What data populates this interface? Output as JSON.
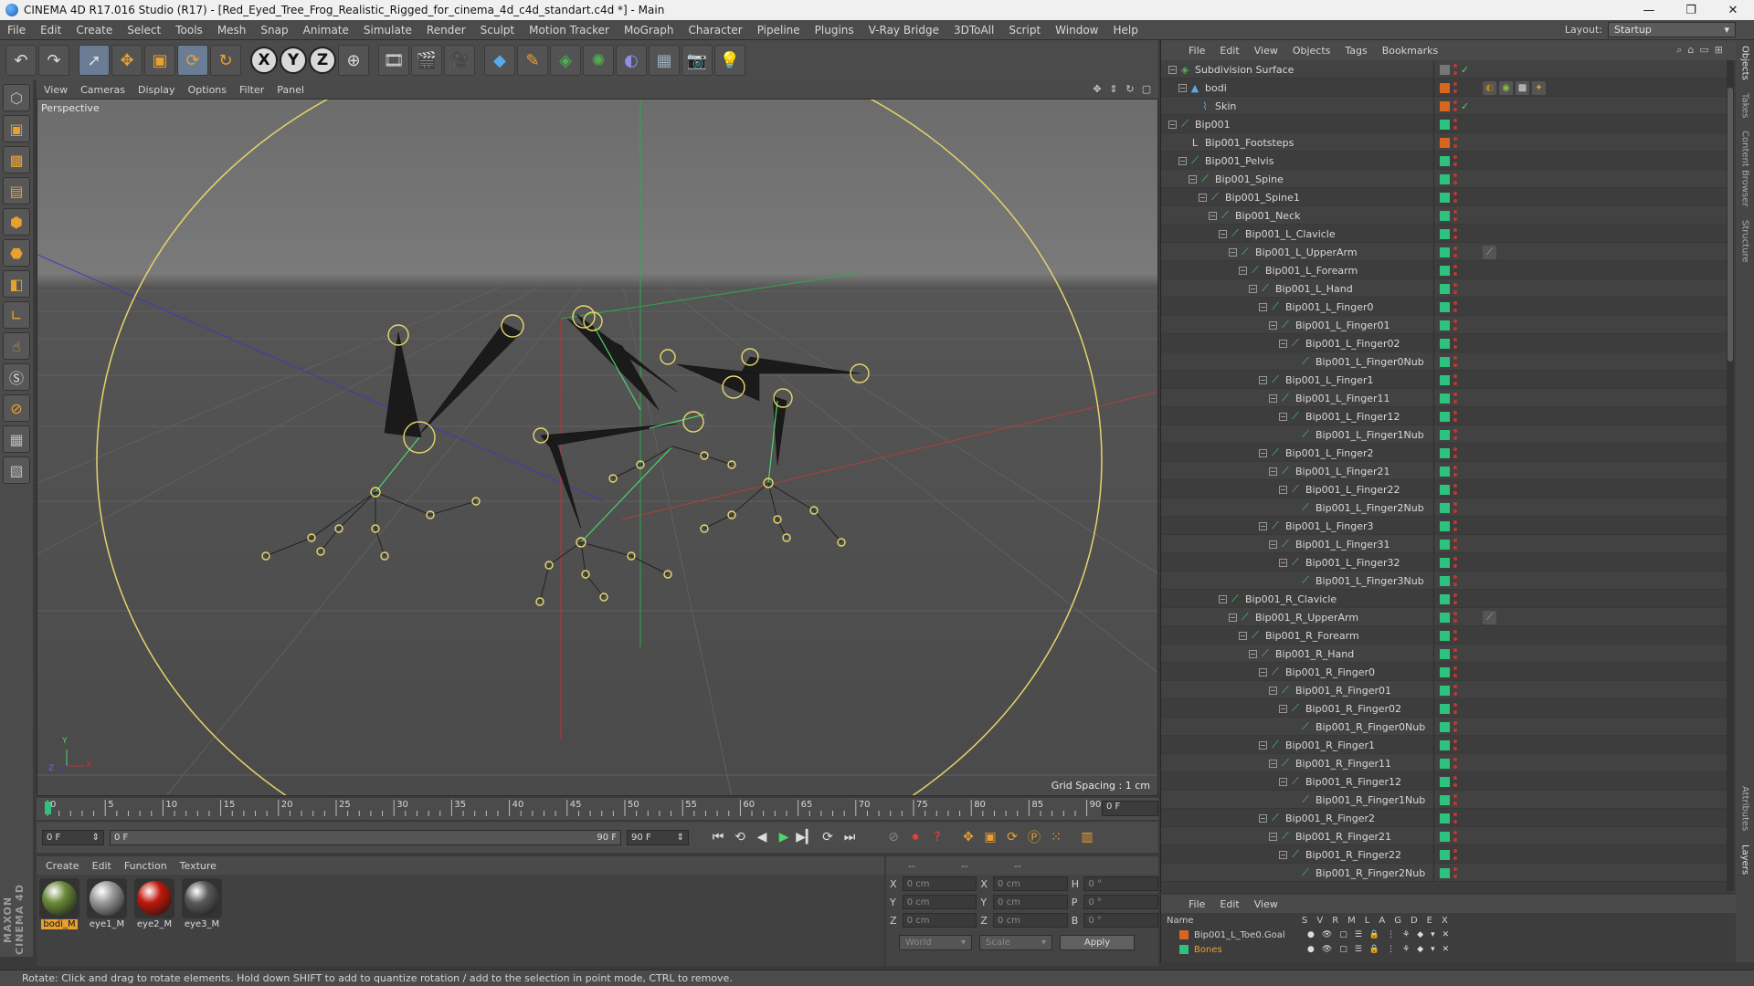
{
  "window": {
    "title": "CINEMA 4D R17.016 Studio (R17) - [Red_Eyed_Tree_Frog_Realistic_Rigged_for_cinema_4d_c4d_standart.c4d *] - Main",
    "minimize": "—",
    "maximize": "❐",
    "close": "✕"
  },
  "menu": [
    "File",
    "Edit",
    "Create",
    "Select",
    "Tools",
    "Mesh",
    "Snap",
    "Animate",
    "Simulate",
    "Render",
    "Sculpt",
    "Motion Tracker",
    "MoGraph",
    "Character",
    "Pipeline",
    "Plugins",
    "V-Ray Bridge",
    "3DToAll",
    "Script",
    "Window",
    "Help"
  ],
  "layout": {
    "label": "Layout:",
    "value": "Startup"
  },
  "toolbar_axes": [
    "X",
    "Y",
    "Z"
  ],
  "viewport": {
    "menu": [
      "View",
      "Cameras",
      "Display",
      "Options",
      "Filter",
      "Panel"
    ],
    "label": "Perspective",
    "grid_spacing": "Grid Spacing : 1 cm",
    "axis_y": "Y",
    "axis_x": "X",
    "axis_z": "Z"
  },
  "timeline": {
    "ticks": [
      "0",
      "5",
      "10",
      "15",
      "20",
      "25",
      "30",
      "35",
      "40",
      "45",
      "50",
      "55",
      "60",
      "65",
      "70",
      "75",
      "80",
      "85",
      "90"
    ],
    "current_frame": "0 F",
    "start_field": "0 F",
    "range_start": "0 F",
    "range_end": "90 F",
    "end_field": "90 F"
  },
  "materials": {
    "menu": [
      "Create",
      "Edit",
      "Function",
      "Texture"
    ],
    "items": [
      {
        "name": "bodi_M",
        "color": "#6b8a3a",
        "selected": true
      },
      {
        "name": "eye1_M",
        "color": "#9a9a9a",
        "selected": false
      },
      {
        "name": "eye2_M",
        "color": "#c0180c",
        "selected": false
      },
      {
        "name": "eye3_M",
        "color": "#5a5a5a",
        "selected": false
      }
    ]
  },
  "coords": {
    "headers": [
      "--",
      "--",
      "--"
    ],
    "rows": [
      {
        "a1": "X",
        "v1": "0 cm",
        "a2": "X",
        "v2": "0 cm",
        "a3": "H",
        "v3": "0 °"
      },
      {
        "a1": "Y",
        "v1": "0 cm",
        "a2": "Y",
        "v2": "0 cm",
        "a3": "P",
        "v3": "0 °"
      },
      {
        "a1": "Z",
        "v1": "0 cm",
        "a2": "Z",
        "v2": "0 cm",
        "a3": "B",
        "v3": "0 °"
      }
    ],
    "world": "World",
    "scale": "Scale",
    "apply": "Apply"
  },
  "object_manager": {
    "menu": [
      "File",
      "Edit",
      "View",
      "Objects",
      "Tags",
      "Bookmarks"
    ],
    "rows": [
      {
        "name": "Subdivision Surface",
        "depth": 0,
        "exp": true,
        "icon": "subdivision",
        "chip": "#777777",
        "check": true
      },
      {
        "name": "bodi",
        "depth": 1,
        "exp": true,
        "icon": "mesh",
        "chip": "#d9661e",
        "tags": true
      },
      {
        "name": "Skin",
        "depth": 2,
        "exp": false,
        "icon": "skin",
        "chip": "#d9661e",
        "check": true
      },
      {
        "name": "Bip001",
        "depth": 0,
        "exp": true,
        "icon": "bone",
        "chip": "#2ec27e"
      },
      {
        "name": "Bip001_Footsteps",
        "depth": 1,
        "exp": false,
        "icon": "null",
        "chip": "#d9661e"
      },
      {
        "name": "Bip001_Pelvis",
        "depth": 1,
        "exp": true,
        "icon": "bone",
        "chip": "#2ec27e"
      },
      {
        "name": "Bip001_Spine",
        "depth": 2,
        "exp": true,
        "icon": "bone",
        "chip": "#2ec27e"
      },
      {
        "name": "Bip001_Spine1",
        "depth": 3,
        "exp": true,
        "icon": "bone",
        "chip": "#2ec27e"
      },
      {
        "name": "Bip001_Neck",
        "depth": 4,
        "exp": true,
        "icon": "bone",
        "chip": "#2ec27e"
      },
      {
        "name": "Bip001_L_Clavicle",
        "depth": 5,
        "exp": true,
        "icon": "bone",
        "chip": "#2ec27e"
      },
      {
        "name": "Bip001_L_UpperArm",
        "depth": 6,
        "exp": true,
        "icon": "bone",
        "chip": "#2ec27e",
        "ik": true
      },
      {
        "name": "Bip001_L_Forearm",
        "depth": 7,
        "exp": true,
        "icon": "bone",
        "chip": "#2ec27e"
      },
      {
        "name": "Bip001_L_Hand",
        "depth": 8,
        "exp": true,
        "icon": "bone",
        "chip": "#2ec27e"
      },
      {
        "name": "Bip001_L_Finger0",
        "depth": 9,
        "exp": true,
        "icon": "bone",
        "chip": "#2ec27e"
      },
      {
        "name": "Bip001_L_Finger01",
        "depth": 10,
        "exp": true,
        "icon": "bone",
        "chip": "#2ec27e"
      },
      {
        "name": "Bip001_L_Finger02",
        "depth": 11,
        "exp": true,
        "icon": "bone",
        "chip": "#2ec27e"
      },
      {
        "name": "Bip001_L_Finger0Nub",
        "depth": 12,
        "exp": false,
        "icon": "bone",
        "chip": "#2ec27e"
      },
      {
        "name": "Bip001_L_Finger1",
        "depth": 9,
        "exp": true,
        "icon": "bone",
        "chip": "#2ec27e"
      },
      {
        "name": "Bip001_L_Finger11",
        "depth": 10,
        "exp": true,
        "icon": "bone",
        "chip": "#2ec27e"
      },
      {
        "name": "Bip001_L_Finger12",
        "depth": 11,
        "exp": true,
        "icon": "bone",
        "chip": "#2ec27e"
      },
      {
        "name": "Bip001_L_Finger1Nub",
        "depth": 12,
        "exp": false,
        "icon": "bone",
        "chip": "#2ec27e"
      },
      {
        "name": "Bip001_L_Finger2",
        "depth": 9,
        "exp": true,
        "icon": "bone",
        "chip": "#2ec27e"
      },
      {
        "name": "Bip001_L_Finger21",
        "depth": 10,
        "exp": true,
        "icon": "bone",
        "chip": "#2ec27e"
      },
      {
        "name": "Bip001_L_Finger22",
        "depth": 11,
        "exp": true,
        "icon": "bone",
        "chip": "#2ec27e"
      },
      {
        "name": "Bip001_L_Finger2Nub",
        "depth": 12,
        "exp": false,
        "icon": "bone",
        "chip": "#2ec27e"
      },
      {
        "name": "Bip001_L_Finger3",
        "depth": 9,
        "exp": true,
        "icon": "bone",
        "chip": "#2ec27e"
      },
      {
        "name": "Bip001_L_Finger31",
        "depth": 10,
        "exp": true,
        "icon": "bone",
        "chip": "#2ec27e"
      },
      {
        "name": "Bip001_L_Finger32",
        "depth": 11,
        "exp": true,
        "icon": "bone",
        "chip": "#2ec27e"
      },
      {
        "name": "Bip001_L_Finger3Nub",
        "depth": 12,
        "exp": false,
        "icon": "bone",
        "chip": "#2ec27e"
      },
      {
        "name": "Bip001_R_Clavicle",
        "depth": 5,
        "exp": true,
        "icon": "bone",
        "chip": "#2ec27e"
      },
      {
        "name": "Bip001_R_UpperArm",
        "depth": 6,
        "exp": true,
        "icon": "bone",
        "chip": "#2ec27e",
        "ik": true
      },
      {
        "name": "Bip001_R_Forearm",
        "depth": 7,
        "exp": true,
        "icon": "bone",
        "chip": "#2ec27e"
      },
      {
        "name": "Bip001_R_Hand",
        "depth": 8,
        "exp": true,
        "icon": "bone",
        "chip": "#2ec27e"
      },
      {
        "name": "Bip001_R_Finger0",
        "depth": 9,
        "exp": true,
        "icon": "bone",
        "chip": "#2ec27e"
      },
      {
        "name": "Bip001_R_Finger01",
        "depth": 10,
        "exp": true,
        "icon": "bone",
        "chip": "#2ec27e"
      },
      {
        "name": "Bip001_R_Finger02",
        "depth": 11,
        "exp": true,
        "icon": "bone",
        "chip": "#2ec27e"
      },
      {
        "name": "Bip001_R_Finger0Nub",
        "depth": 12,
        "exp": false,
        "icon": "bone",
        "chip": "#2ec27e"
      },
      {
        "name": "Bip001_R_Finger1",
        "depth": 9,
        "exp": true,
        "icon": "bone",
        "chip": "#2ec27e"
      },
      {
        "name": "Bip001_R_Finger11",
        "depth": 10,
        "exp": true,
        "icon": "bone",
        "chip": "#2ec27e"
      },
      {
        "name": "Bip001_R_Finger12",
        "depth": 11,
        "exp": true,
        "icon": "bone",
        "chip": "#2ec27e"
      },
      {
        "name": "Bip001_R_Finger1Nub",
        "depth": 12,
        "exp": false,
        "icon": "bone",
        "chip": "#2ec27e"
      },
      {
        "name": "Bip001_R_Finger2",
        "depth": 9,
        "exp": true,
        "icon": "bone",
        "chip": "#2ec27e"
      },
      {
        "name": "Bip001_R_Finger21",
        "depth": 10,
        "exp": true,
        "icon": "bone",
        "chip": "#2ec27e"
      },
      {
        "name": "Bip001_R_Finger22",
        "depth": 11,
        "exp": true,
        "icon": "bone",
        "chip": "#2ec27e"
      },
      {
        "name": "Bip001_R_Finger2Nub",
        "depth": 12,
        "exp": false,
        "icon": "bone",
        "chip": "#2ec27e"
      }
    ]
  },
  "side_tabs": [
    "Objects",
    "Takes",
    "Content Browser",
    "Structure",
    "Attributes",
    "Layers"
  ],
  "layer_manager": {
    "menu": [
      "File",
      "Edit",
      "View"
    ],
    "name_header": "Name",
    "columns": [
      "S",
      "V",
      "R",
      "M",
      "L",
      "A",
      "G",
      "D",
      "E",
      "X"
    ],
    "rows": [
      {
        "name": "Bip001_L_Toe0.Goal",
        "color": "#d9661e"
      },
      {
        "name": "Bones",
        "color": "#2ec27e"
      }
    ]
  },
  "status": "Rotate: Click and drag to rotate elements. Hold down SHIFT to add to quantize rotation / add to the selection in point mode, CTRL to remove.",
  "brand": "MAXON CINEMA 4D"
}
